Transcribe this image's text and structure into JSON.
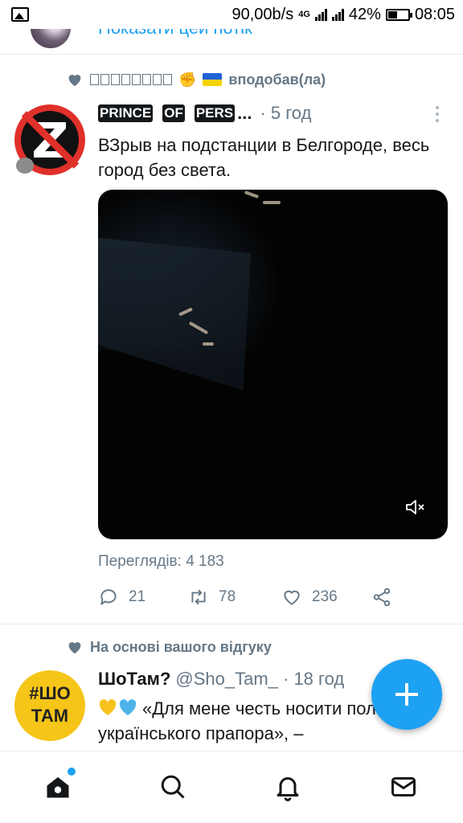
{
  "status_bar": {
    "speed": "90,00b/s",
    "network": "4G",
    "battery": "42%",
    "time": "08:05"
  },
  "previous_item": {
    "link": "Показати цей потік"
  },
  "tweet1": {
    "social_context": "вподобав(ла)",
    "social_user_emoji": "✊",
    "author_name_words": [
      "PRINCE",
      "OF",
      "PERS"
    ],
    "author_ellipsis": "...",
    "time": "· 5 год",
    "text": "ВЗрыв на подстанции в Белгороде, весь город без света.",
    "views": "Переглядів: 4 183",
    "replies": "21",
    "retweets": "78",
    "likes": "236"
  },
  "tweet2": {
    "social_context": "На основі вашого відгуку",
    "avatar_line1": "#ШО",
    "avatar_line2": "ТАМ",
    "author_name": "ШоТам?",
    "handle_time": "@Sho_Tam_ · 18 год",
    "text": "«Для мене честь носити половину українського прапора», –"
  },
  "icons": {
    "nav": [
      "home-icon",
      "search-icon",
      "notifications-icon",
      "messages-icon"
    ],
    "fab": "compose-icon"
  },
  "colors": {
    "accent": "#1da1f2",
    "muted": "#657786",
    "divider": "#e6ecf0"
  }
}
